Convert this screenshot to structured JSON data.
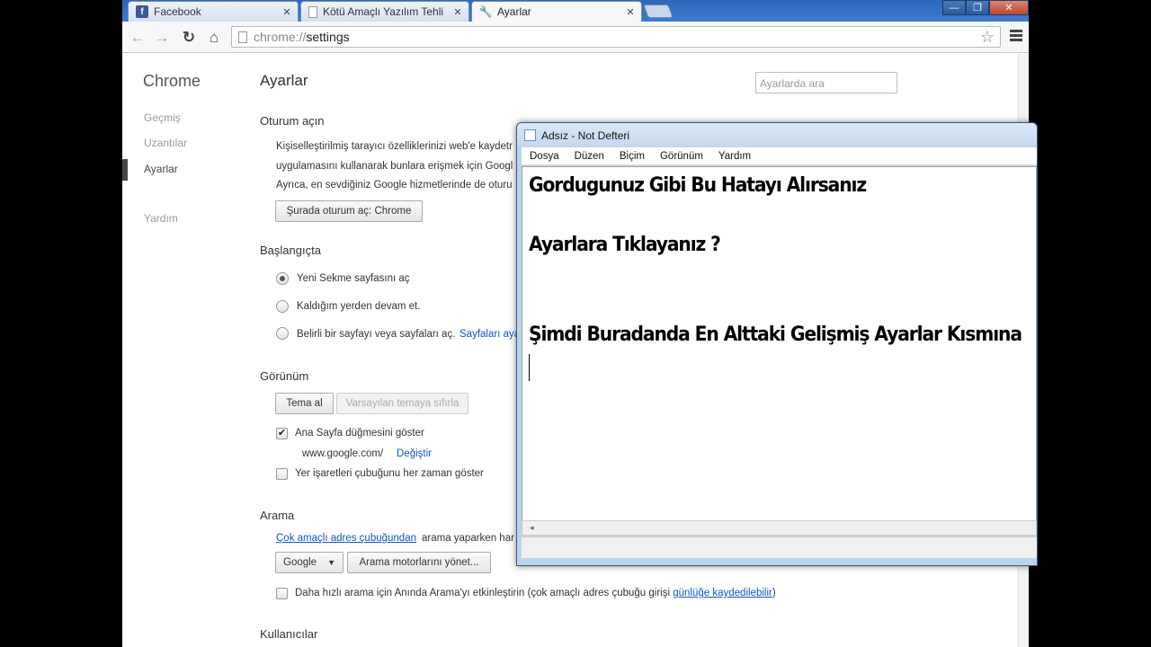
{
  "tabs": [
    {
      "title": "Facebook",
      "icon": "facebook-icon"
    },
    {
      "title": "Kötü Amaçlı Yazılım Tehli",
      "icon": "page-icon"
    },
    {
      "title": "Ayarlar",
      "icon": "wrench-icon"
    }
  ],
  "toolbar": {
    "url_scheme": "chrome://",
    "url_path": "settings"
  },
  "sidebar": {
    "title": "Chrome",
    "items": [
      {
        "label": "Geçmiş"
      },
      {
        "label": "Uzantılar"
      },
      {
        "label": "Ayarlar"
      },
      {
        "label": "Yardım"
      }
    ]
  },
  "settings": {
    "title": "Ayarlar",
    "search_placeholder": "Ayarlarda ara",
    "signin": {
      "title": "Oturum açın",
      "line1": "Kişiselleştirilmiş tarayıcı özelliklerinizi web'e kaydetr",
      "line2": "uygulamasını kullanarak bunlara erişmek için Googl",
      "line3": "Ayrıca, en sevdiğiniz Google hizmetlerinde de oturu",
      "button": "Şurada oturum aç: Chrome"
    },
    "startup": {
      "title": "Başlangıçta",
      "opt1": "Yeni Sekme sayfasını aç",
      "opt2": "Kaldığım yerden devam et.",
      "opt3": "Belirli bir sayfayı veya sayfaları aç.",
      "opt3_link": "Sayfaları aya"
    },
    "appearance": {
      "title": "Görünüm",
      "theme_button": "Tema al",
      "reset_button": "Varsayılan temaya sıfırla",
      "home_check": "Ana Sayfa düğmesini göster",
      "home_url": "www.google.com/",
      "home_change": "Değiştir",
      "bookmarks_check": "Yer işaretleri çubuğunu her zaman göster"
    },
    "search": {
      "title": "Arama",
      "omni_link": "Çok amaçlı adres çubuğundan",
      "omni_text": "arama yaparken har",
      "engine": "Google",
      "manage_button": "Arama motorlarını yönet...",
      "instant_text": "Daha hızlı arama için Anında Arama'yı etkinleştirin (çok amaçlı adres çubuğu girişi",
      "instant_link": "günlüğe kaydedilebilir",
      "instant_close": ")"
    },
    "users": {
      "title": "Kullanıcılar"
    }
  },
  "notepad": {
    "title": "Adsız - Not Defteri",
    "menu": [
      "Dosya",
      "Düzen",
      "Biçim",
      "Görünüm",
      "Yardım"
    ],
    "lines": [
      "Gordugunuz Gibi Bu Hatayı Alırsanız",
      "Ayarlara Tıklayanız ?",
      "Şimdi Buradanda En Alttaki Gelişmiş Ayarlar Kısmına"
    ]
  }
}
